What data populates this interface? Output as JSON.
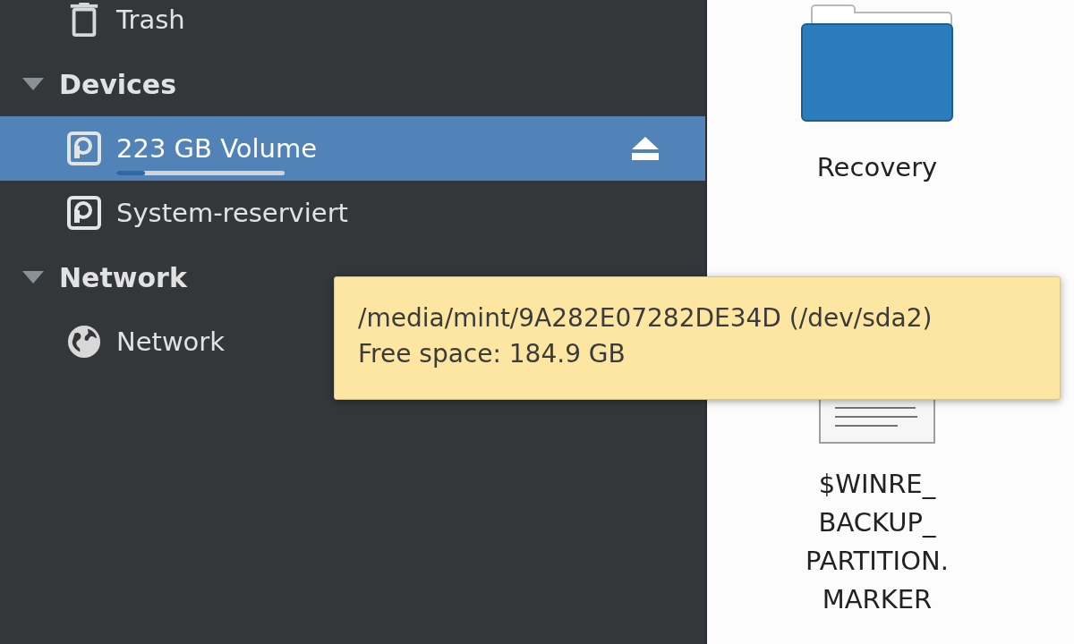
{
  "sidebar": {
    "top_items": [
      {
        "label": "Trash",
        "kind": "trash",
        "selected": false
      }
    ],
    "sections": [
      {
        "title": "Devices",
        "expanded": true,
        "items": [
          {
            "label": "223 GB Volume",
            "kind": "drive",
            "selected": true,
            "ejectable": true,
            "level": 0.17
          },
          {
            "label": "System-reserviert",
            "kind": "drive",
            "selected": false,
            "ejectable": false
          }
        ]
      },
      {
        "title": "Network",
        "expanded": true,
        "items": [
          {
            "label": "Network",
            "kind": "globe",
            "selected": false,
            "ejectable": false
          }
        ]
      }
    ]
  },
  "files": [
    {
      "name": "Recovery",
      "kind": "folder"
    },
    {
      "name": "$WINRE_BACKUP_PARTITION.MARKER",
      "kind": "document"
    }
  ],
  "tooltip": {
    "lines": [
      "/media/mint/9A282E07282DE34D (/dev/sda2)",
      "Free space: 184.9 GB"
    ]
  }
}
